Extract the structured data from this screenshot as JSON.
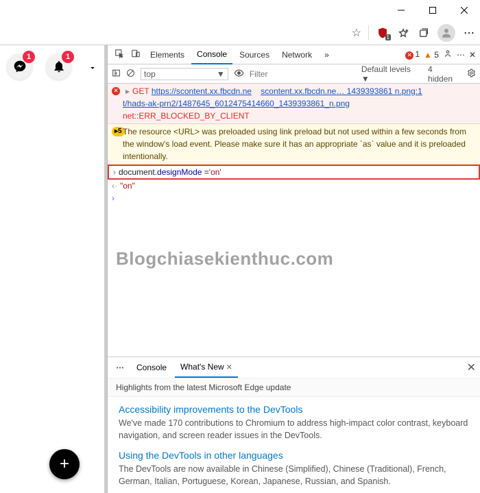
{
  "window": {
    "buttons": [
      "minimize",
      "maximize",
      "close"
    ]
  },
  "toolbar": {
    "star": "☆",
    "shield_badge": "1"
  },
  "left_panel": {
    "messenger_badge": "1",
    "bell_badge": "1",
    "fab_label": "+"
  },
  "devtools": {
    "tabs": [
      "Elements",
      "Console",
      "Sources",
      "Network"
    ],
    "active_tab": "Console",
    "more": "»",
    "errors": "1",
    "warnings": "5",
    "options": "⋯"
  },
  "filter": {
    "context": "top",
    "filter_placeholder": "Filter",
    "levels": "Default levels ▼",
    "hidden": "4 hidden"
  },
  "console": {
    "error": {
      "method": "GET",
      "url1": "https://scontent.xx.fbcdn.ne",
      "url2_text": "scontent.xx.fbcdn.ne… 1439393861 n.png:1",
      "url3": "t/hads-ak-prn2/1487645_6012475414660_1439393861_n.png",
      "status": "net::ERR_BLOCKED_BY_CLIENT"
    },
    "warn": {
      "count": "5",
      "text": "The resource <URL> was preloaded using link preload but not used within a few seconds from the window's load event. Please make sure it has an appropriate `as` value and it is preloaded intentionally."
    },
    "input": {
      "prefix": "document.",
      "prop": "designMode",
      "assign": " =",
      "value": "'on'"
    },
    "output": "\"on\""
  },
  "watermark": "Blogchiasekienthuc.com",
  "drawer": {
    "tabs": [
      "Console",
      "What's New"
    ],
    "active": "What's New",
    "subtitle": "Highlights from the latest Microsoft Edge update",
    "items": [
      {
        "title": "Accessibility improvements to the DevTools",
        "text": "We've made 170 contributions to Chromium to address high-impact color contrast, keyboard navigation, and screen reader issues in the DevTools."
      },
      {
        "title": "Using the DevTools in other languages",
        "text": "The DevTools are now available in Chinese (Simplified), Chinese (Traditional), French, German, Italian, Portuguese, Korean, Japanese, Russian, and Spanish."
      }
    ]
  }
}
